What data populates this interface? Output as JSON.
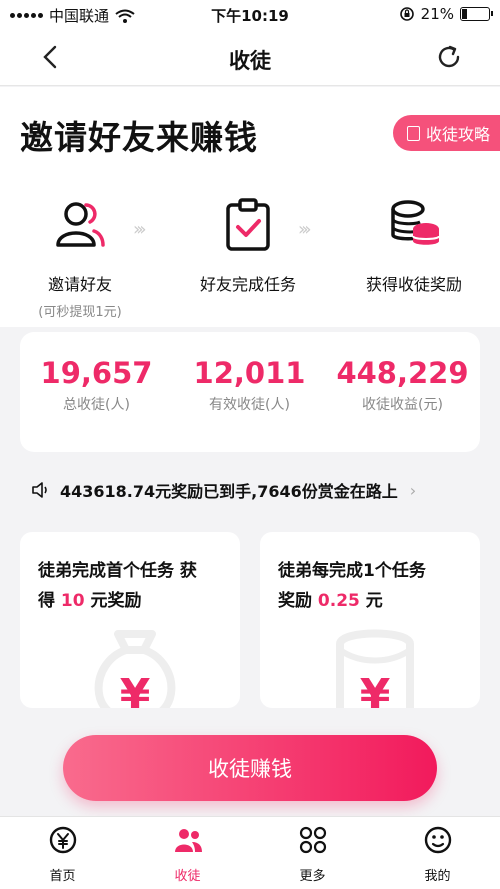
{
  "status_bar": {
    "carrier": "中国联通",
    "time": "下午10:19",
    "battery": "21%",
    "battery_level": 0.21,
    "icons": [
      "signal-icon",
      "wifi-icon",
      "rotation-lock-icon",
      "battery-icon"
    ]
  },
  "nav": {
    "title": "收徒",
    "back_icon": "chevron-left-icon",
    "refresh_icon": "refresh-icon"
  },
  "hero": {
    "headline": "邀请好友来赚钱",
    "guide_label": "收徒攻略"
  },
  "steps": [
    {
      "label": "邀请好友",
      "sub": "(可秒提现1元)",
      "icon": "users-icon"
    },
    {
      "label": "好友完成任务",
      "icon": "clipboard-check-icon"
    },
    {
      "label": "获得收徒奖励",
      "icon": "coins-icon"
    }
  ],
  "stats": [
    {
      "value": "19,657",
      "caption": "总收徒(人)"
    },
    {
      "value": "12,011",
      "caption": "有效收徒(人)"
    },
    {
      "value": "448,229",
      "caption": "收徒收益(元)"
    }
  ],
  "ticker": {
    "text": "443618.74元奖励已到手,7646份赏金在路上",
    "icon": "speaker-icon"
  },
  "cards": [
    {
      "line1": "徒弟完成首个任务 获",
      "line2_pre": "得 ",
      "amount": "10",
      "line2_post": " 元奖励",
      "icon": "money-bag-icon"
    },
    {
      "line1": "徒弟每完成1个任务",
      "line2_pre": "奖励 ",
      "amount": "0.25",
      "line2_post": " 元",
      "icon": "red-envelope-icon"
    }
  ],
  "cta": {
    "label": "收徒赚钱"
  },
  "tabs": [
    {
      "label": "首页",
      "icon": "yen-coin-icon",
      "active": false
    },
    {
      "label": "收徒",
      "icon": "people-icon",
      "active": true
    },
    {
      "label": "更多",
      "icon": "grid-icon",
      "active": false
    },
    {
      "label": "我的",
      "icon": "smiley-icon",
      "active": false
    }
  ],
  "colors": {
    "accent": "#ee2a68",
    "button_start": "#f96b8d",
    "button_end": "#f21a5c"
  }
}
